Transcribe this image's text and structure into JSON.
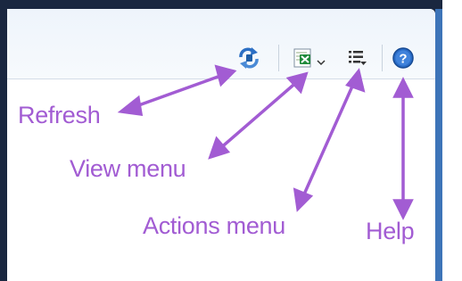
{
  "toolbar": {
    "buttons": [
      {
        "id": "refresh",
        "icon": "refresh-icon"
      },
      {
        "id": "view",
        "icon": "excel-icon"
      },
      {
        "id": "actions",
        "icon": "list-menu-icon"
      },
      {
        "id": "help",
        "icon": "help-icon"
      }
    ]
  },
  "callouts": {
    "refresh": "Refresh",
    "view_menu": "View menu",
    "actions_menu": "Actions menu",
    "help": "Help"
  },
  "colors": {
    "annotation": "#a25cd3",
    "accent_blue": "#3d74b8",
    "window_bg": "#1a2740"
  }
}
